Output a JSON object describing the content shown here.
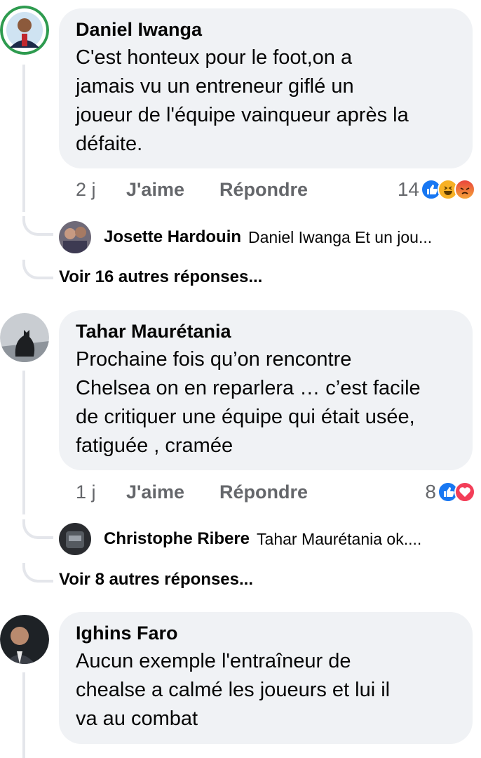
{
  "comments": [
    {
      "author": "Daniel Iwanga",
      "text": "C'est honteux pour le foot,on a jamais vu un entreneur giflé un joueur de l'équipe vainqueur après la défaite.",
      "lines": [
        "C'est honteux pour le foot,on a",
        "jamais vu un entreneur giflé un",
        "joueur de l'équipe vainqueur après la",
        "défaite."
      ],
      "age": "2 j",
      "like_label": "J'aime",
      "reply_label": "Répondre",
      "reaction_count": "14",
      "reactions": [
        "like-icon",
        "haha-icon",
        "angry-icon"
      ],
      "reply_preview": {
        "author": "Josette Hardouin",
        "text": "Daniel Iwanga Et un jou..."
      },
      "more_replies": "Voir 16 autres réponses..."
    },
    {
      "author": "Tahar Maurétania",
      "text": "Prochaine fois qu'on rencontre Chelsea on en reparlera … c'est facile de critiquer une équipe qui était usée, fatiguée , cramée",
      "lines": [
        "Prochaine fois qu’on rencontre",
        "Chelsea on en reparlera … c’est facile",
        "de critiquer une équipe qui était usée,",
        "fatiguée , cramée"
      ],
      "age": "1 j",
      "like_label": "J'aime",
      "reply_label": "Répondre",
      "reaction_count": "8",
      "reactions": [
        "like-icon",
        "love-icon"
      ],
      "reply_preview": {
        "author": "Christophe Ribere",
        "text": "Tahar Maurétania ok...."
      },
      "more_replies": "Voir 8 autres réponses..."
    },
    {
      "author": "Ighins Faro",
      "lines": [
        "Aucun exemple l'entraîneur de",
        "chealse a calmé les joueurs et lui il",
        "va au combat"
      ]
    }
  ],
  "colors": {
    "bubble": "#f0f2f5",
    "like": "#1877f2",
    "meta": "#65676b"
  }
}
